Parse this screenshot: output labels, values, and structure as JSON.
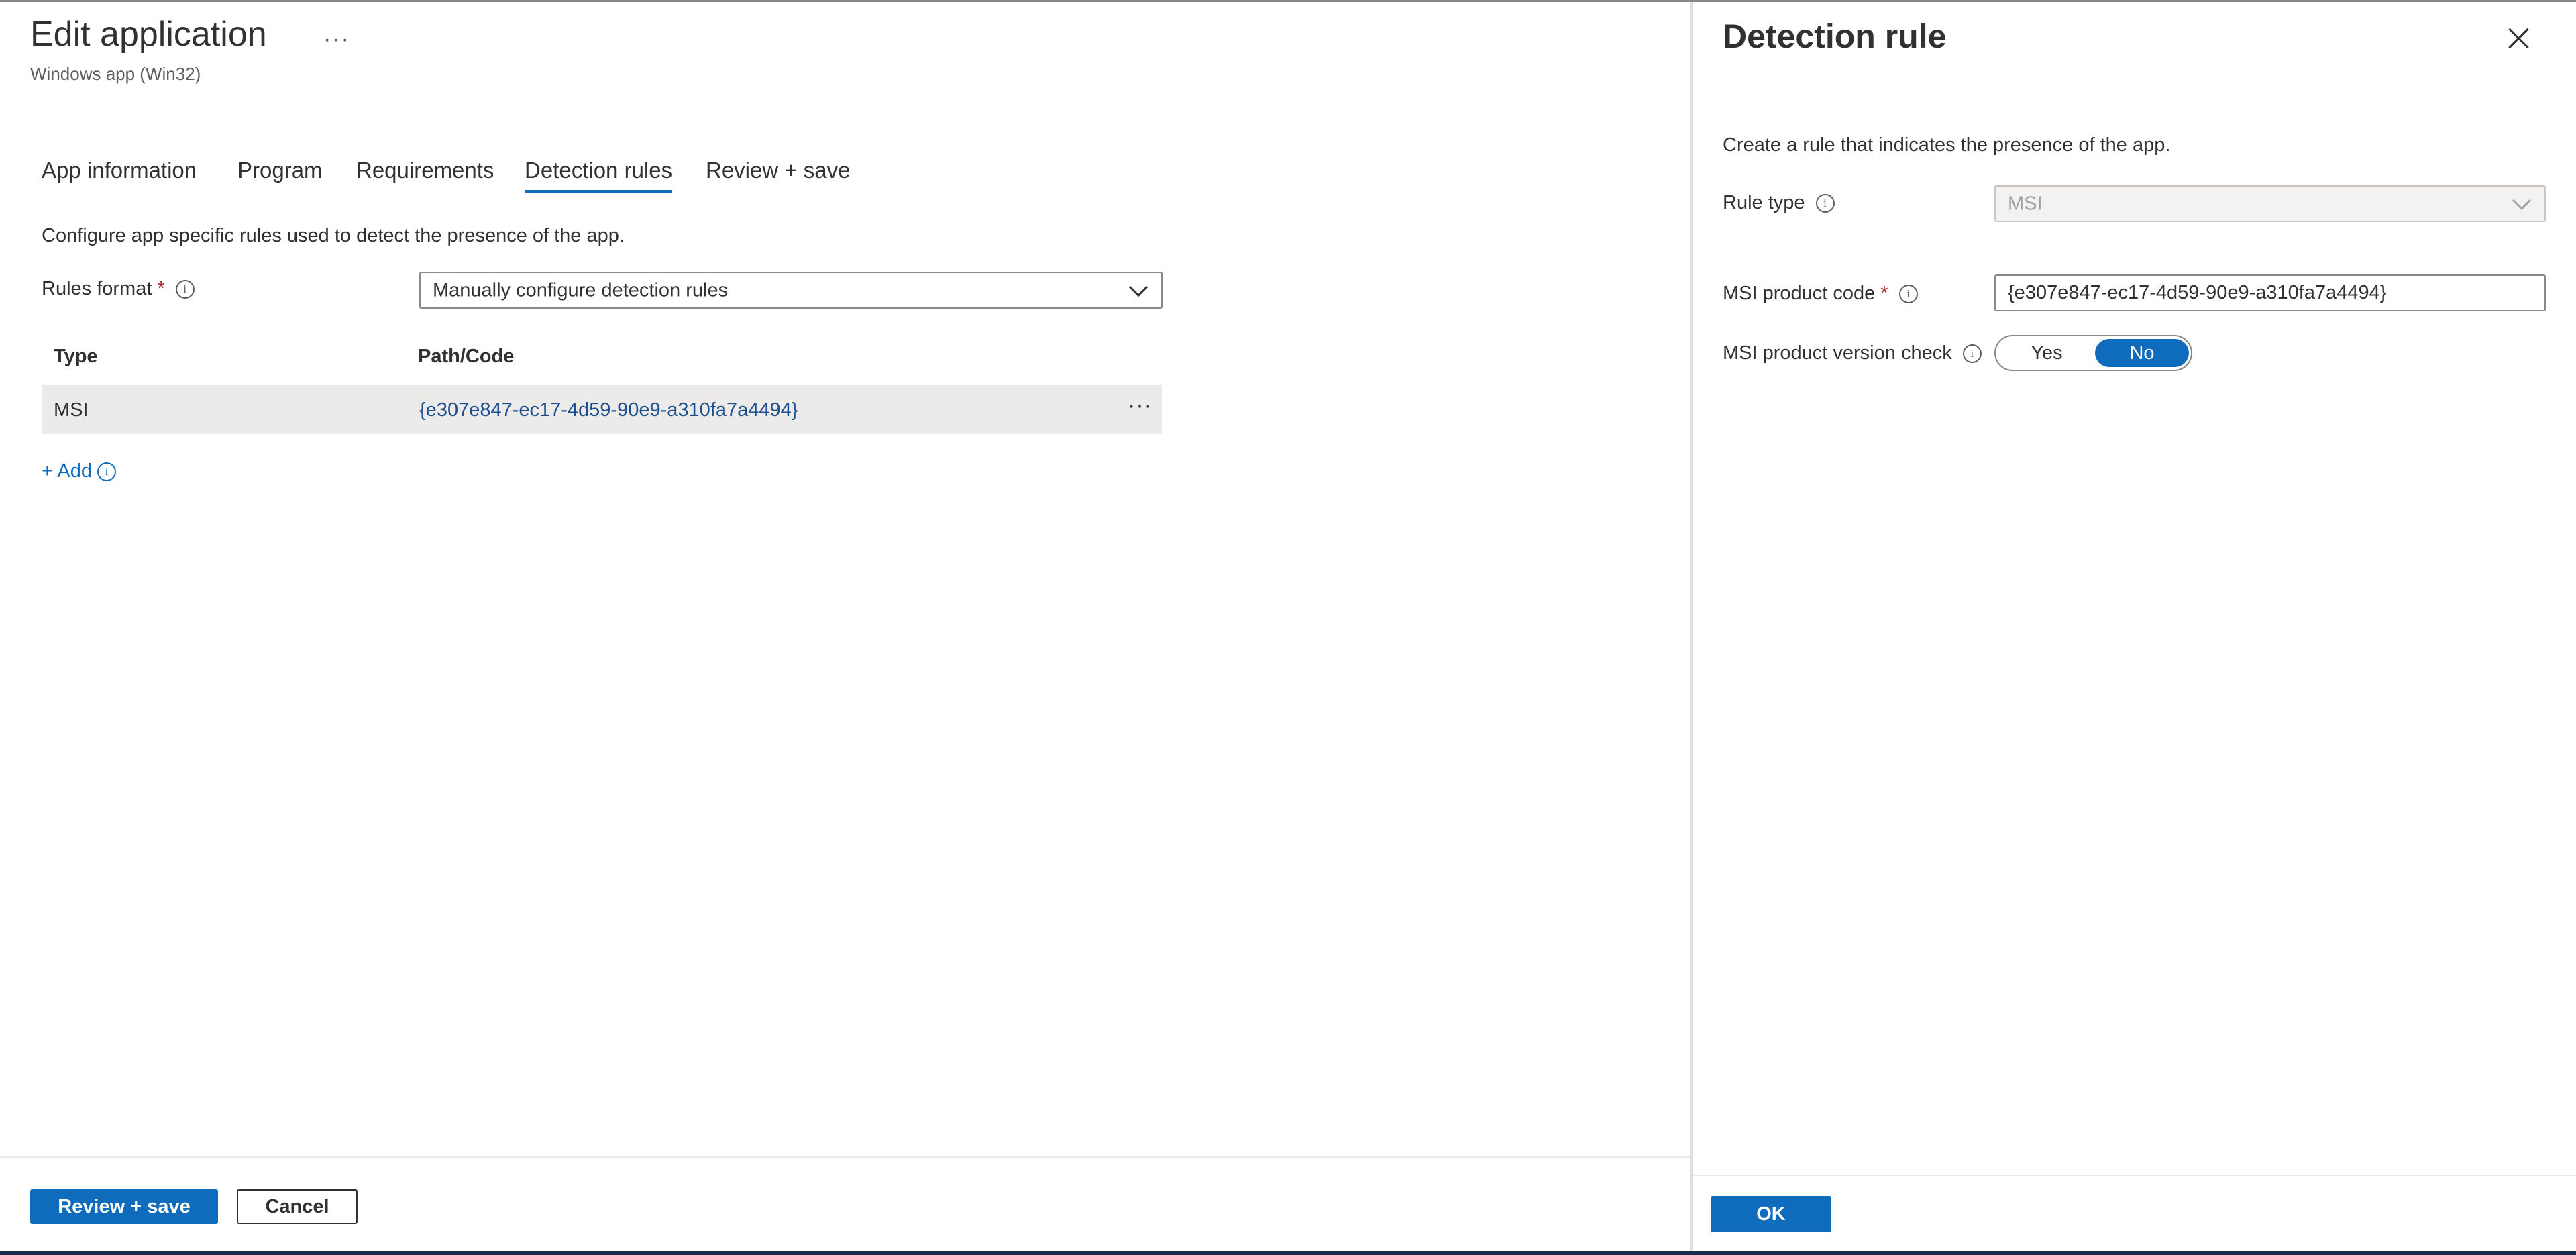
{
  "header": {
    "title": "Edit application",
    "more_label": "···",
    "subtitle": "Windows app (Win32)"
  },
  "tabs": [
    {
      "label": "App information"
    },
    {
      "label": "Program"
    },
    {
      "label": "Requirements"
    },
    {
      "label": "Detection rules",
      "active": true
    },
    {
      "label": "Review + save"
    }
  ],
  "main": {
    "description": "Configure app specific rules used to detect the presence of the app.",
    "rules_format_label": "Rules format",
    "required_mark": "*",
    "info_icon": "i",
    "rules_format_value": "Manually configure detection rules",
    "table": {
      "headers": [
        "Type",
        "Path/Code"
      ],
      "rows": [
        {
          "type": "MSI",
          "path_code": "{e307e847-ec17-4d59-90e9-a310fa7a4494}",
          "more": "···"
        }
      ]
    },
    "add_label": "+ Add"
  },
  "footer": {
    "review_save": "Review + save",
    "cancel": "Cancel"
  },
  "panel": {
    "title": "Detection rule",
    "description": "Create a rule that indicates the presence of the app.",
    "rule_type_label": "Rule type",
    "rule_type_value": "MSI",
    "msi_code_label": "MSI product code",
    "msi_code_value": "{e307e847-ec17-4d59-90e9-a310fa7a4494}",
    "version_check_label": "MSI product version check",
    "yes": "Yes",
    "no": "No",
    "selected": "No",
    "ok": "OK"
  },
  "colors": {
    "accent": "#0f6cbd",
    "required": "#a4262c",
    "row_highlight": "#edebe9"
  }
}
